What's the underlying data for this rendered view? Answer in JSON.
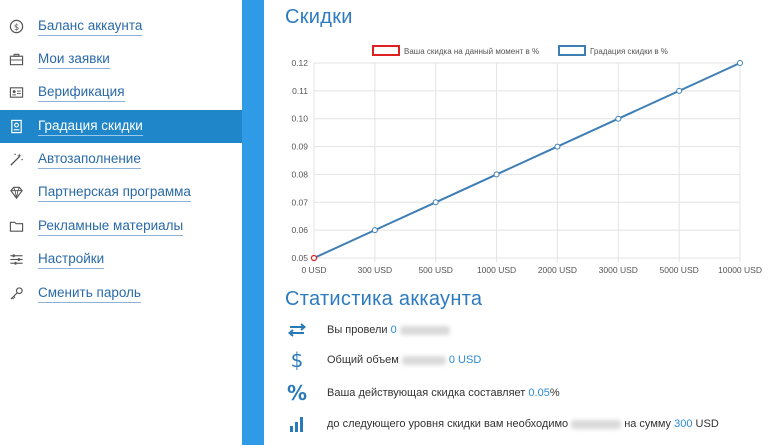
{
  "sidebar": {
    "items": [
      {
        "label": "Баланс аккаунта",
        "icon": "dollar-circle-icon"
      },
      {
        "label": "Мои заявки",
        "icon": "briefcase-icon"
      },
      {
        "label": "Верификация",
        "icon": "id-card-icon"
      },
      {
        "label": "Градация скидки",
        "icon": "badge-icon",
        "active": true
      },
      {
        "label": "Автозаполнение",
        "icon": "magic-wand-icon"
      },
      {
        "label": "Партнерская программа",
        "icon": "diamond-icon"
      },
      {
        "label": "Рекламные материалы",
        "icon": "folder-icon"
      },
      {
        "label": "Настройки",
        "icon": "sliders-icon"
      },
      {
        "label": "Сменить пароль",
        "icon": "key-icon"
      }
    ]
  },
  "main": {
    "title": "Скидки",
    "stats_title": "Статистика аккаунта",
    "stats": [
      {
        "icon": "exchange-arrows-icon",
        "prefix": "Вы провели",
        "value": "0",
        "suffix": ""
      },
      {
        "icon": "dollar-sign-icon",
        "prefix": "Общий объем",
        "value": "0 USD",
        "suffix": ""
      },
      {
        "icon": "percent-icon",
        "prefix": "Ваша действующая скидка составляет",
        "value": "0.05",
        "suffix": "%"
      },
      {
        "icon": "bar-chart-icon",
        "prefix": "до следующего уровня скидки вам необходимо",
        "value": "300",
        "suffix": "USD",
        "mid": "на сумму"
      }
    ]
  },
  "colors": {
    "accent": "#2d7bbf",
    "active_bg": "#1f86c9",
    "divider": "#2f9ae6",
    "series_line": "#3d7eb5",
    "current_marker": "#e02020"
  },
  "chart_data": {
    "type": "line",
    "categories": [
      "0 USD",
      "300 USD",
      "500 USD",
      "1000 USD",
      "2000 USD",
      "3000 USD",
      "5000 USD",
      "10000 USD"
    ],
    "series": [
      {
        "name": "Ваша скидка на данный момент в %",
        "values": [
          0.05,
          null,
          null,
          null,
          null,
          null,
          null,
          null
        ]
      },
      {
        "name": "Градация скидки в %",
        "values": [
          0.05,
          0.06,
          0.07,
          0.08,
          0.09,
          0.1,
          0.11,
          0.12
        ]
      }
    ],
    "yticks": [
      "0.05",
      "0.06",
      "0.07",
      "0.08",
      "0.09",
      "0.10",
      "0.11",
      "0.12"
    ],
    "ylim": [
      0.05,
      0.12
    ],
    "grid": true,
    "legend": "top-center"
  }
}
